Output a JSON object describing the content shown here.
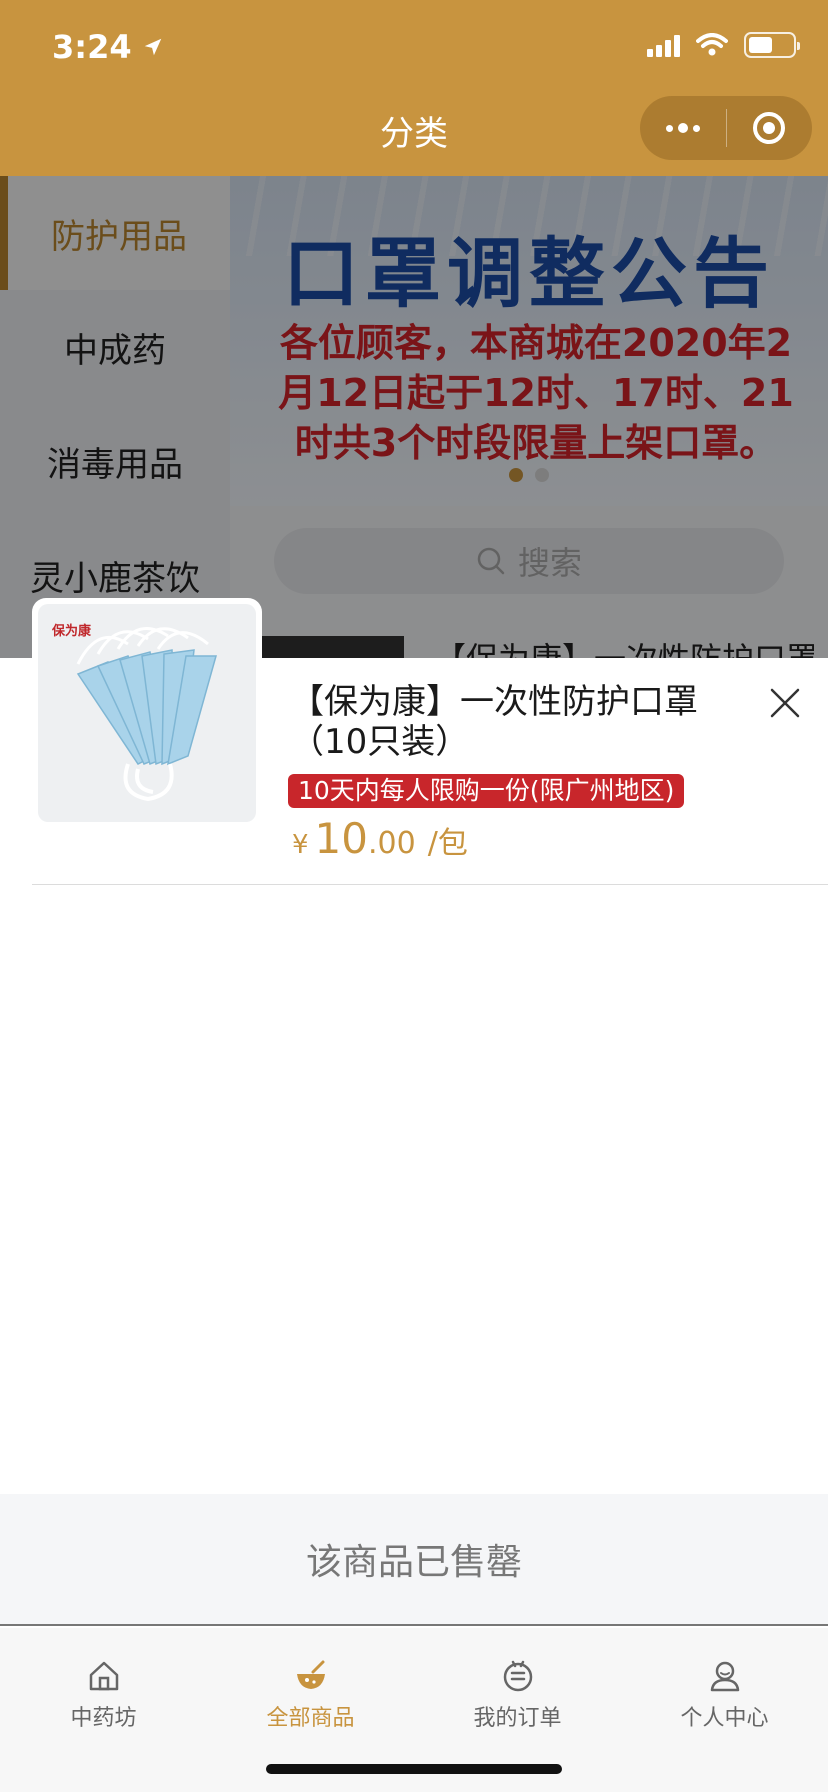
{
  "status_bar": {
    "time": "3:24",
    "battery_level": 0.55
  },
  "nav": {
    "title": "分类"
  },
  "sidebar": {
    "items": [
      {
        "label": "防护用品",
        "active": true
      },
      {
        "label": "中成药",
        "active": false
      },
      {
        "label": "消毒用品",
        "active": false
      },
      {
        "label": "灵小鹿茶饮",
        "active": false
      }
    ]
  },
  "banner": {
    "title": "口罩调整公告",
    "text": "各位顾客，本商城在2020年2月12日起于12时、17时、21时共3个时段限量上架口罩。"
  },
  "search": {
    "placeholder": "搜索"
  },
  "list_preview": {
    "title": "【保为康】一次性防护口罩"
  },
  "product": {
    "image_brand": "保为康",
    "name": "【保为康】一次性防护口罩（10只装）",
    "limit_tag": "10天内每人限购一份(限广州地区)",
    "price_symbol": "¥",
    "price_int": "10",
    "price_dec": ".00",
    "price_unit": "/包"
  },
  "soldout": {
    "label": "该商品已售罄"
  },
  "tabbar": {
    "items": [
      {
        "label": "中药坊",
        "icon": "home-icon",
        "active": false
      },
      {
        "label": "全部商品",
        "icon": "medicine-bowl-icon",
        "active": true
      },
      {
        "label": "我的订单",
        "icon": "order-icon",
        "active": false
      },
      {
        "label": "个人中心",
        "icon": "user-icon",
        "active": false
      }
    ]
  },
  "colors": {
    "accent": "#c8943f",
    "tag_red": "#c8262b",
    "banner_blue": "#1c4da6"
  }
}
